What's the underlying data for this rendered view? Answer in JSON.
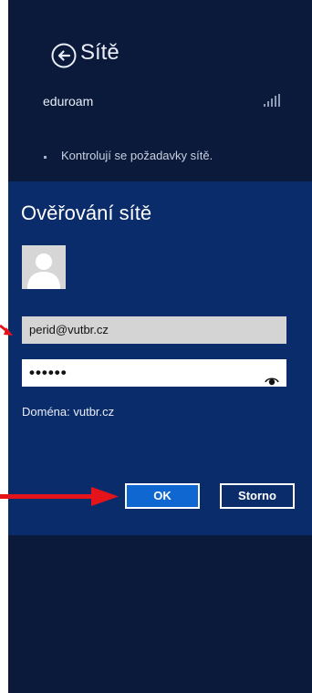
{
  "header": {
    "title": "Sítě",
    "back_icon": "back-arrow-circle-icon"
  },
  "network": {
    "name": "eduroam",
    "signal_icon": "signal-strength-icon",
    "status": "Kontrolují se požadavky sítě."
  },
  "dialog": {
    "title": "Ověřování sítě",
    "avatar_icon": "user-avatar-icon",
    "username_value": "perid@vutbr.cz",
    "password_value": "••••••",
    "reveal_icon": "reveal-password-icon",
    "domain_text": "Doména: vutbr.cz",
    "ok_label": "OK",
    "cancel_label": "Storno"
  },
  "colors": {
    "panel_bg": "#0b1a3a",
    "dialog_bg": "#0a2c6b",
    "accent": "#0f67d2",
    "annotation_arrow": "#e5141b"
  }
}
